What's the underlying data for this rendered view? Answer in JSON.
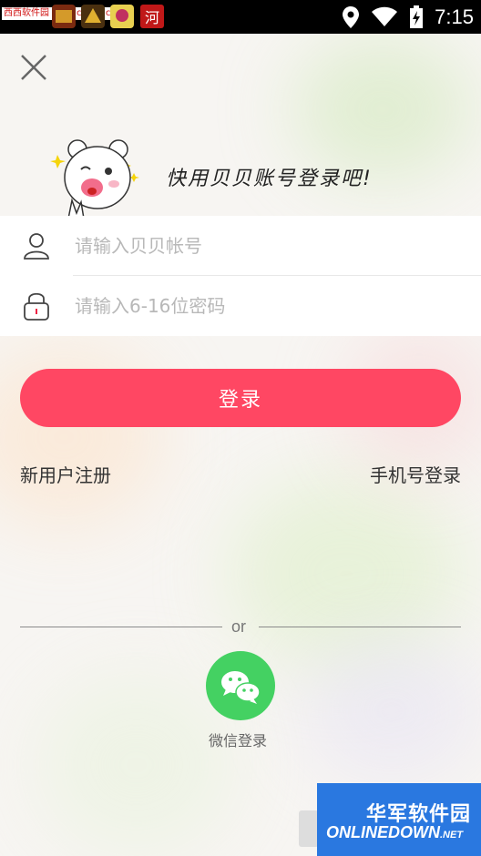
{
  "status_bar": {
    "time": "7:15",
    "watermark_top": "西西软件园 www.cr173.com",
    "icons": [
      "search-icon",
      "app-icon-1",
      "app-icon-2",
      "app-icon-3",
      "app-icon-4",
      "location-icon",
      "wifi-icon",
      "battery-icon"
    ]
  },
  "header": {
    "close_icon": "close-icon",
    "slogan": "快用贝贝账号登录吧!"
  },
  "form": {
    "account_placeholder": "请输入贝贝帐号",
    "password_placeholder": "请输入6-16位密码",
    "account_icon": "user-icon",
    "password_icon": "lock-icon"
  },
  "actions": {
    "login_label": "登录",
    "register_label": "新用户注册",
    "phone_login_label": "手机号登录"
  },
  "social": {
    "or_text": "or",
    "wechat_label": "微信登录"
  },
  "watermark_bottom": {
    "cn": "华军软件园",
    "en": "ONLINEDOWN",
    "net": ".NET"
  },
  "colors": {
    "primary": "#ff4763",
    "wechat": "#44d162",
    "status_bar": "#000000"
  }
}
